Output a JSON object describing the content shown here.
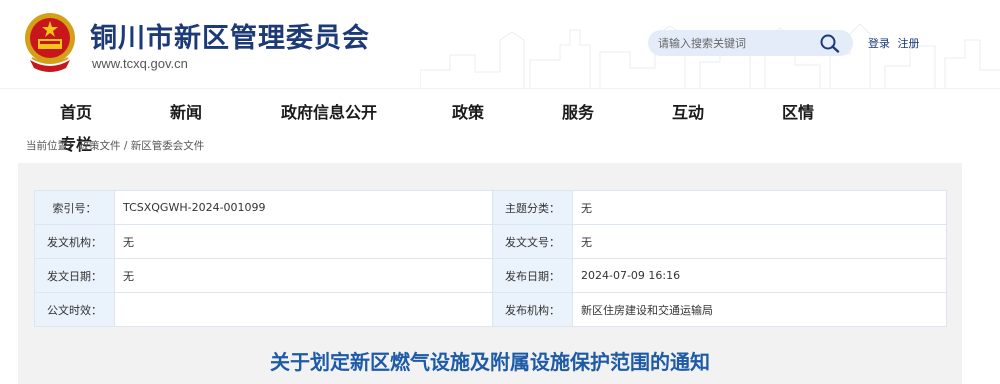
{
  "header": {
    "site_title": "铜川市新区管理委员会",
    "site_url": "www.tcxq.gov.cn",
    "search_placeholder": "请输入搜索关键词",
    "login_label": "登录",
    "register_label": "注册"
  },
  "nav": {
    "items": [
      "首页",
      "新闻",
      "政府信息公开",
      "政策",
      "服务",
      "互动",
      "区情"
    ],
    "overflow_item": "专栏"
  },
  "breadcrumb": {
    "prefix": "当前位置：",
    "path": "政策文件 / 新区管委会文件"
  },
  "info": {
    "rows": [
      {
        "k1": "索引号：",
        "v1": "TCSXQGWH-2024-001099",
        "k2": "主题分类：",
        "v2": "无"
      },
      {
        "k1": "发文机构：",
        "v1": "无",
        "k2": "发文文号：",
        "v2": "无"
      },
      {
        "k1": "发文日期：",
        "v1": "无",
        "k2": "发布日期：",
        "v2": "2024-07-09 16:16"
      },
      {
        "k1": "公文时效：",
        "v1": "",
        "k2": "发布机构：",
        "v2": "新区住房建设和交通运输局"
      }
    ]
  },
  "article": {
    "title": "关于划定新区燃气设施及附属设施保护范围的通知"
  },
  "colors": {
    "brand_blue": "#1d3a78",
    "title_blue": "#1d5aa8",
    "label_bg": "#eaf2fb",
    "panel_bg": "#f2f2f2"
  }
}
